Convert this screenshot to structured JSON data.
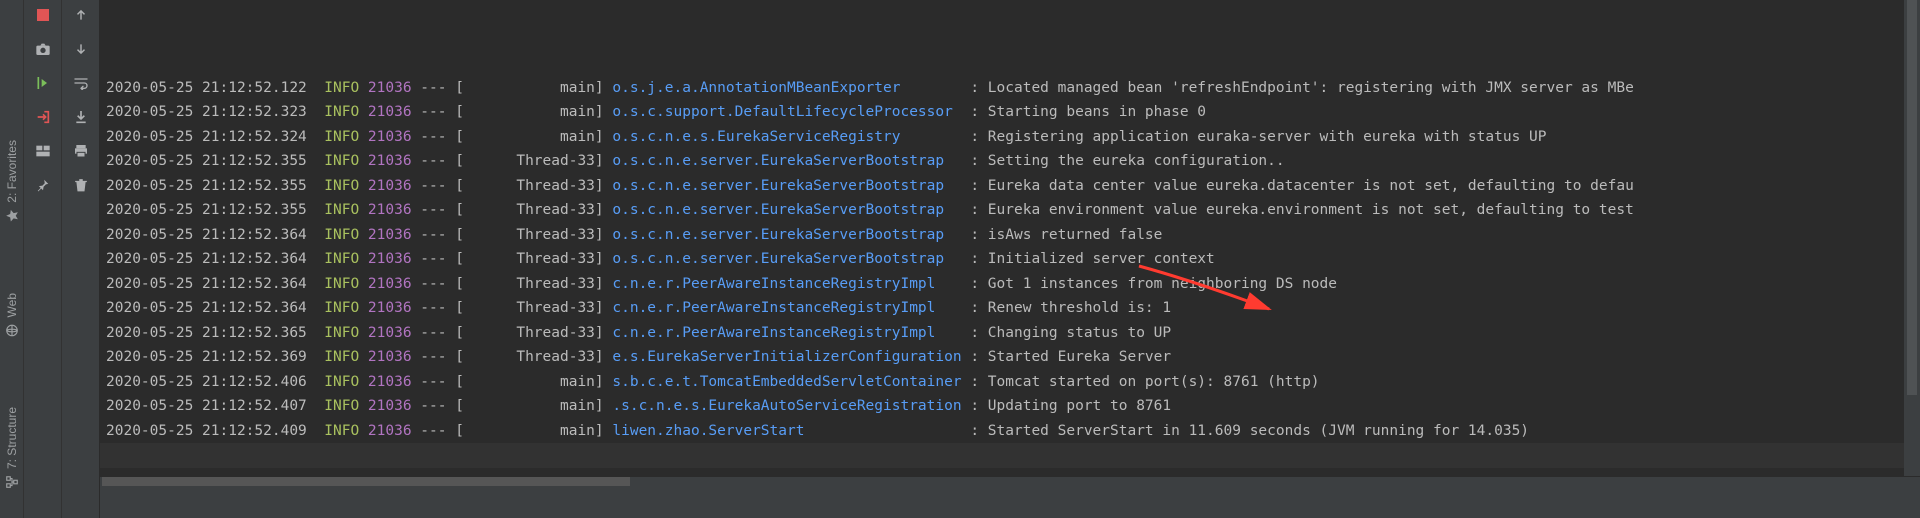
{
  "sideTabs": {
    "favorites": {
      "label": "2: Favorites"
    },
    "web": {
      "label": "Web"
    },
    "structure": {
      "label": "7: Structure"
    }
  },
  "gutterIcons": [
    "stop-icon",
    "camera-icon",
    "run-to-icon",
    "exit-icon",
    "layout-icon",
    "pin-icon"
  ],
  "gutter2Icons": [
    "arrow-up-icon",
    "arrow-down-icon",
    "wrap-icon",
    "scroll-end-icon",
    "print-icon",
    "trash-icon"
  ],
  "columns": {
    "sep": " --- [",
    "colon": " : "
  },
  "logs": [
    {
      "ts": "2020-05-25 21:12:52.122",
      "lvl": "INFO",
      "pid": "21036",
      "thr": "           main]",
      "logger": "o.s.j.e.a.AnnotationMBeanExporter       ",
      "msg": "Located managed bean 'refreshEndpoint': registering with JMX server as MBe"
    },
    {
      "ts": "2020-05-25 21:12:52.323",
      "lvl": "INFO",
      "pid": "21036",
      "thr": "           main]",
      "logger": "o.s.c.support.DefaultLifecycleProcessor ",
      "msg": "Starting beans in phase 0"
    },
    {
      "ts": "2020-05-25 21:12:52.324",
      "lvl": "INFO",
      "pid": "21036",
      "thr": "           main]",
      "logger": "o.s.c.n.e.s.EurekaServiceRegistry       ",
      "msg": "Registering application euraka-server with eureka with status UP"
    },
    {
      "ts": "2020-05-25 21:12:52.355",
      "lvl": "INFO",
      "pid": "21036",
      "thr": "      Thread-33]",
      "logger": "o.s.c.n.e.server.EurekaServerBootstrap  ",
      "msg": "Setting the eureka configuration.."
    },
    {
      "ts": "2020-05-25 21:12:52.355",
      "lvl": "INFO",
      "pid": "21036",
      "thr": "      Thread-33]",
      "logger": "o.s.c.n.e.server.EurekaServerBootstrap  ",
      "msg": "Eureka data center value eureka.datacenter is not set, defaulting to defau"
    },
    {
      "ts": "2020-05-25 21:12:52.355",
      "lvl": "INFO",
      "pid": "21036",
      "thr": "      Thread-33]",
      "logger": "o.s.c.n.e.server.EurekaServerBootstrap  ",
      "msg": "Eureka environment value eureka.environment is not set, defaulting to test"
    },
    {
      "ts": "2020-05-25 21:12:52.364",
      "lvl": "INFO",
      "pid": "21036",
      "thr": "      Thread-33]",
      "logger": "o.s.c.n.e.server.EurekaServerBootstrap  ",
      "msg": "isAws returned false"
    },
    {
      "ts": "2020-05-25 21:12:52.364",
      "lvl": "INFO",
      "pid": "21036",
      "thr": "      Thread-33]",
      "logger": "o.s.c.n.e.server.EurekaServerBootstrap  ",
      "msg": "Initialized server context"
    },
    {
      "ts": "2020-05-25 21:12:52.364",
      "lvl": "INFO",
      "pid": "21036",
      "thr": "      Thread-33]",
      "logger": "c.n.e.r.PeerAwareInstanceRegistryImpl   ",
      "msg": "Got 1 instances from neighboring DS node"
    },
    {
      "ts": "2020-05-25 21:12:52.364",
      "lvl": "INFO",
      "pid": "21036",
      "thr": "      Thread-33]",
      "logger": "c.n.e.r.PeerAwareInstanceRegistryImpl   ",
      "msg": "Renew threshold is: 1"
    },
    {
      "ts": "2020-05-25 21:12:52.365",
      "lvl": "INFO",
      "pid": "21036",
      "thr": "      Thread-33]",
      "logger": "c.n.e.r.PeerAwareInstanceRegistryImpl   ",
      "msg": "Changing status to UP"
    },
    {
      "ts": "2020-05-25 21:12:52.369",
      "lvl": "INFO",
      "pid": "21036",
      "thr": "      Thread-33]",
      "logger": "e.s.EurekaServerInitializerConfiguration",
      "msg": "Started Eureka Server"
    },
    {
      "ts": "2020-05-25 21:12:52.406",
      "lvl": "INFO",
      "pid": "21036",
      "thr": "           main]",
      "logger": "s.b.c.e.t.TomcatEmbeddedServletContainer",
      "msg": "Tomcat started on port(s): 8761 (http)"
    },
    {
      "ts": "2020-05-25 21:12:52.407",
      "lvl": "INFO",
      "pid": "21036",
      "thr": "           main]",
      "logger": ".s.c.n.e.s.EurekaAutoServiceRegistration",
      "msg": "Updating port to 8761"
    },
    {
      "ts": "2020-05-25 21:12:52.409",
      "lvl": "INFO",
      "pid": "21036",
      "thr": "           main]",
      "logger": "liwen.zhao.ServerStart                  ",
      "msg": "Started ServerStart in 11.609 seconds (JVM running for 14.035)"
    }
  ]
}
